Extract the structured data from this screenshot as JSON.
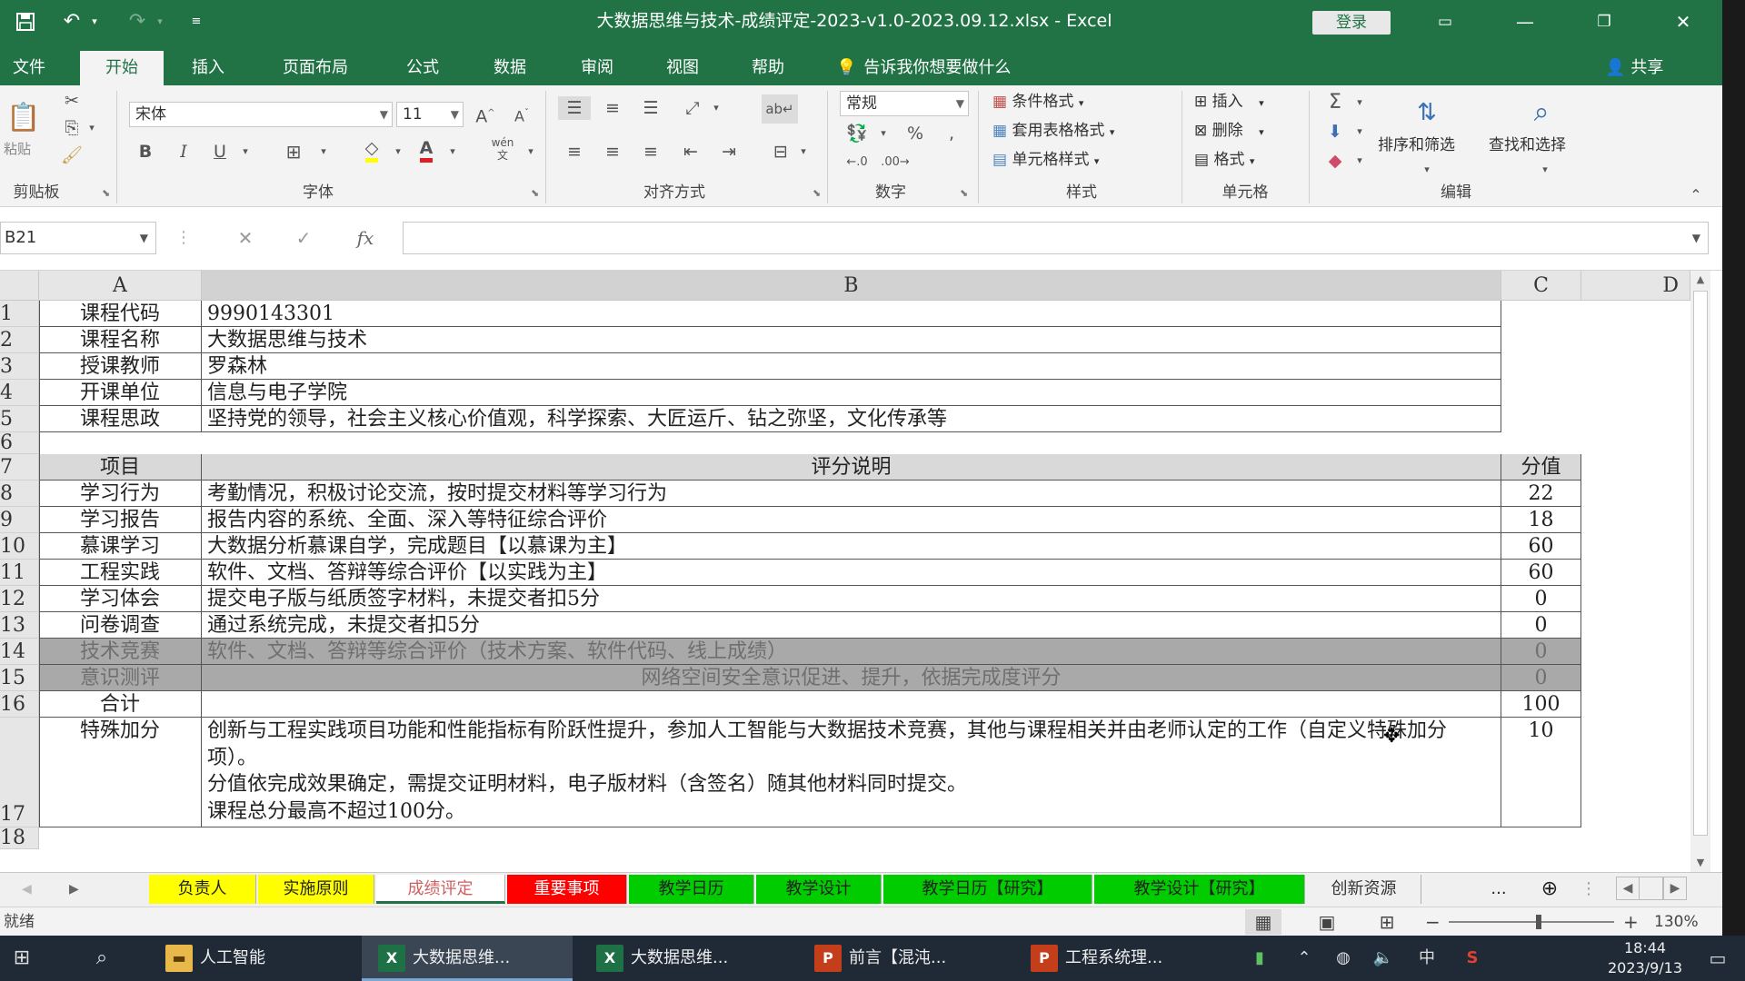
{
  "titlebar": {
    "title": "大数据思维与技术-成绩评定-2023-v1.0-2023.09.12.xlsx  -  Excel",
    "login": "登录",
    "save_icon": "save-icon",
    "undo_icon": "undo-icon",
    "redo_icon": "redo-icon"
  },
  "tabs": [
    "文件",
    "开始",
    "插入",
    "页面布局",
    "公式",
    "数据",
    "审阅",
    "视图",
    "帮助"
  ],
  "tell_me": "告诉我你想要做什么",
  "share": "共享",
  "ribbon": {
    "clipboard_partial": "粘贴",
    "font_name": "宋体",
    "font_size": "11",
    "font_bold": "B",
    "font_italic": "I",
    "font_underline": "U",
    "wen_label": "wén",
    "number_format": "常规",
    "cond_format": "条件格式",
    "table_format": "套用表格格式",
    "cell_style": "单元格样式",
    "insert": "插入",
    "delete": "删除",
    "format": "格式",
    "sort_filter": "排序和筛选",
    "find_select": "查找和选择",
    "groups": {
      "clipboard": "剪贴板",
      "font": "字体",
      "align": "对齐方式",
      "number": "数字",
      "styles": "样式",
      "cells": "单元格",
      "editing": "编辑"
    }
  },
  "formula": {
    "namebox": "B21",
    "fx": "fx",
    "value": ""
  },
  "columns": [
    "A",
    "B",
    "C",
    "D"
  ],
  "rows": [
    {
      "num": "1",
      "a": "课程代码",
      "b": "9990143301",
      "c": ""
    },
    {
      "num": "2",
      "a": "课程名称",
      "b": "大数据思维与技术",
      "c": ""
    },
    {
      "num": "3",
      "a": "授课教师",
      "b": "罗森林",
      "c": ""
    },
    {
      "num": "4",
      "a": "开课单位",
      "b": "信息与电子学院",
      "c": ""
    },
    {
      "num": "5",
      "a": "课程思政",
      "b": "坚持党的领导，社会主义核心价值观，科学探索、大匠运斤、钻之弥坚，文化传承等",
      "c": ""
    },
    {
      "num": "6",
      "a": "",
      "b": "",
      "c": ""
    },
    {
      "num": "7",
      "a": "项目",
      "b": "评分说明",
      "c": "分值"
    },
    {
      "num": "8",
      "a": "学习行为",
      "b": "考勤情况，积极讨论交流，按时提交材料等学习行为",
      "c": "22"
    },
    {
      "num": "9",
      "a": "学习报告",
      "b": "报告内容的系统、全面、深入等特征综合评价",
      "c": "18"
    },
    {
      "num": "10",
      "a": "慕课学习",
      "b": "大数据分析慕课自学，完成题目【以慕课为主】",
      "c": "60"
    },
    {
      "num": "11",
      "a": "工程实践",
      "b": "软件、文档、答辩等综合评价【以实践为主】",
      "c": "60"
    },
    {
      "num": "12",
      "a": "学习体会",
      "b": "提交电子版与纸质签字材料，未提交者扣5分",
      "c": "0"
    },
    {
      "num": "13",
      "a": "问卷调查",
      "b": "通过系统完成，未提交者扣5分",
      "c": "0"
    },
    {
      "num": "14",
      "a": "技术竞赛",
      "b": "软件、文档、答辩等综合评价（技术方案、软件代码、线上成绩）",
      "c": "0"
    },
    {
      "num": "15",
      "a": "意识测评",
      "b": "网络空间安全意识促进、提升，依据完成度评分",
      "c": "0"
    },
    {
      "num": "16",
      "a": "合计",
      "b": "",
      "c": "100"
    },
    {
      "num": "17",
      "a": "特殊加分",
      "b": "创新与工程实践项目功能和性能指标有阶跃性提升，参加人工智能与大数据技术竞赛，其他与课程相关并由老师认定的工作（自定义特殊加分项）。\n分值依完成效果确定，需提交证明材料，电子版材料（含签名）随其他材料同时提交。\n课程总分最高不超过100分。",
      "c": "10"
    },
    {
      "num": "18",
      "a": "",
      "b": "",
      "c": ""
    }
  ],
  "sheets": [
    {
      "name": "负责人",
      "bg": "#ffff00",
      "fg": "#222222"
    },
    {
      "name": "实施原则",
      "bg": "#ffff00",
      "fg": "#222222"
    },
    {
      "name": "成绩评定",
      "bg": "#ffffff",
      "fg": "#d06060"
    },
    {
      "name": "重要事项",
      "bg": "#ff0000",
      "fg": "#ffffff"
    },
    {
      "name": "教学日历",
      "bg": "#00cc00",
      "fg": "#222222"
    },
    {
      "name": "教学设计",
      "bg": "#00cc00",
      "fg": "#222222"
    },
    {
      "name": "教学日历【研究】",
      "bg": "#00cc00",
      "fg": "#222222"
    },
    {
      "name": "教学设计【研究】",
      "bg": "#00cc00",
      "fg": "#222222"
    },
    {
      "name": "创新资源",
      "bg": "#f0f0f0",
      "fg": "#333333"
    }
  ],
  "sheet_more": "...",
  "status": {
    "ready": "就绪",
    "zoom": "130%"
  },
  "taskbar": {
    "items": [
      {
        "label": "人工智能",
        "icon": "folder-icon"
      },
      {
        "label": "大数据思维...",
        "icon": "excel-icon"
      },
      {
        "label": "大数据思维...",
        "icon": "excel-icon"
      },
      {
        "label": "前言【混沌...",
        "icon": "powerpoint-icon"
      },
      {
        "label": "工程系统理...",
        "icon": "powerpoint-icon"
      }
    ],
    "ime": "中",
    "time": "18:44",
    "date": "2023/9/13"
  },
  "colors": {
    "excel_green": "#217346",
    "header_row": "#d9d9d9",
    "gray_row": "#a9a9a9"
  }
}
